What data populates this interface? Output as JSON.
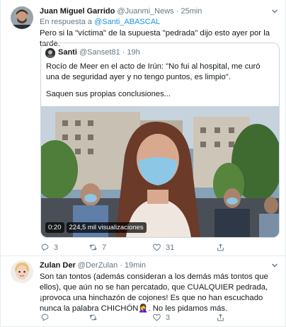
{
  "tweet1": {
    "author_name": "Juan Miguel Garrido",
    "author_handle": "@Juanmi_News",
    "separator": "·",
    "time": "25min",
    "reply_prefix": "En respuesta a",
    "reply_mention": "@Santi_ABASCAL",
    "text": "Pero si la \"víctima\" de la supuesta \"pedrada\" dijo esto ayer por la tarde.",
    "quote": {
      "author_name": "Santi",
      "author_handle": "@Sanset81",
      "separator": "·",
      "time": "19h",
      "text_line1": "Rocío de Meer en el acto de Irún: \"No fui al hospital, me curó una de seguridad ayer y no tengo puntos, es limpio\".",
      "text_line2": "Saquen sus propias conclusiones...",
      "video_time": "0:20",
      "video_views": "224,5 mil visualizaciones"
    },
    "replies": "3",
    "retweets": "7",
    "likes": "31"
  },
  "tweet2": {
    "author_name": "Zulan Der",
    "author_handle": "@DerZulan",
    "separator": "·",
    "time": "19min",
    "text": "Son tan tontos (además consideran a los demás más tontos que ellos), que aún no se han percatado, que CUALQUIER pedrada, ¡provoca una hinchazón de cojones! Es que no han escuchado nunca la palabra CHICHÓN🤦‍♀️. No les pidamos más.",
    "replies": "",
    "retweets": "",
    "likes": "3"
  },
  "icons": {
    "reply": "reply-icon",
    "retweet": "retweet-icon",
    "like": "heart-icon",
    "share": "share-icon",
    "caret": "chevron-down-icon"
  },
  "colors": {
    "link": "#1b95e0",
    "secondary_text": "#657786",
    "border": "#e6ecf0"
  }
}
